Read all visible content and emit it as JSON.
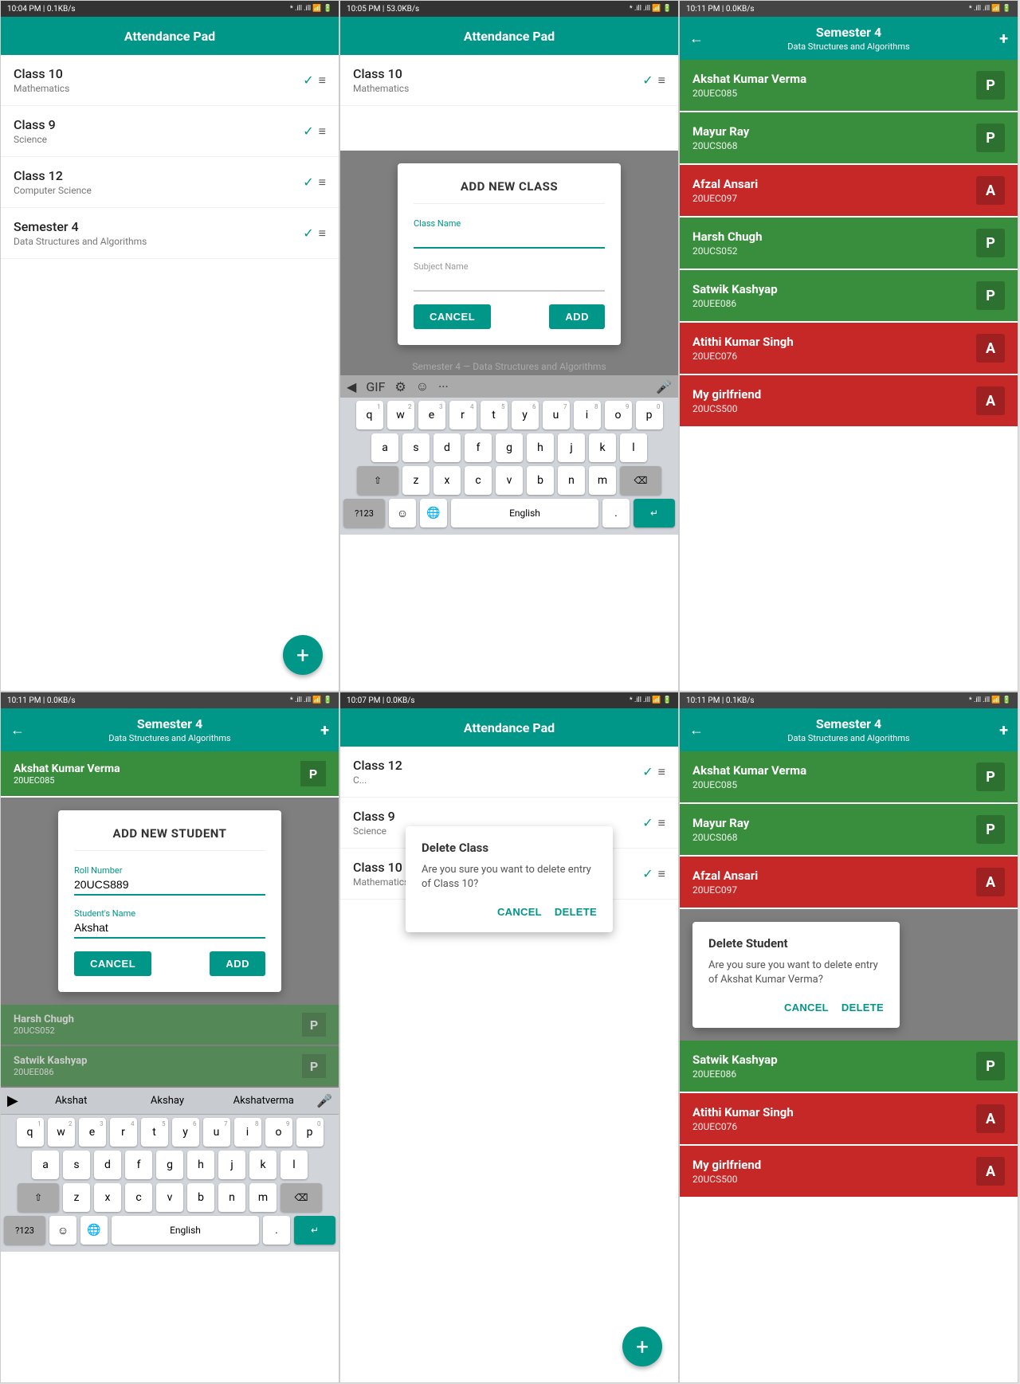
{
  "screen1": {
    "statusBar": {
      "time": "10:04 PM | 0.1KB/s",
      "icons": "bluetooth wifi battery"
    },
    "appBar": {
      "title": "Attendance Pad"
    },
    "classes": [
      {
        "title": "Class 10",
        "sub": "Mathematics"
      },
      {
        "title": "Class 9",
        "sub": "Science"
      },
      {
        "title": "Class 12",
        "sub": "Computer Science"
      },
      {
        "title": "Semester 4",
        "sub": "Data Structures and Algorithms"
      }
    ],
    "fab": "+"
  },
  "screen2": {
    "statusBar": {
      "time": "10:05 PM | 53.0KB/s",
      "icons": "bluetooth wifi battery"
    },
    "appBar": {
      "title": "Attendance Pad"
    },
    "classes": [
      {
        "title": "Class 10",
        "sub": "Mathematics"
      },
      {
        "title": "Semester 4",
        "sub": "Data Structures and Algorithms"
      }
    ],
    "dialog": {
      "title": "ADD NEW CLASS",
      "field1Label": "Class Name",
      "field1Value": "",
      "field2Label": "Subject Name",
      "field2Value": "",
      "cancelBtn": "CANCEL",
      "addBtn": "ADD"
    },
    "keyboard": {
      "toolbar": [
        "←",
        "gif",
        "⚙",
        "☺",
        "...",
        "🎤"
      ],
      "rows": [
        [
          "q",
          "w",
          "e",
          "r",
          "t",
          "y",
          "u",
          "i",
          "o",
          "p"
        ],
        [
          "a",
          "s",
          "d",
          "f",
          "g",
          "h",
          "j",
          "k",
          "l"
        ],
        [
          "⇧",
          "z",
          "x",
          "c",
          "v",
          "b",
          "n",
          "m",
          "⌫"
        ],
        [
          "?123",
          "☺",
          "🌐",
          "English",
          ".",
          "↵"
        ]
      ]
    }
  },
  "screen3": {
    "statusBar": {
      "time": "10:11 PM | 0.0KB/s",
      "icons": "bluetooth wifi battery"
    },
    "appBar": {
      "title": "Semester 4",
      "subtitle": "Data Structures and Algorithms",
      "backBtn": "←",
      "addBtn": "+"
    },
    "students": [
      {
        "name": "Akshat Kumar Verma",
        "roll": "20UEC085",
        "status": "P",
        "color": "green"
      },
      {
        "name": "Mayur Ray",
        "roll": "20UCS068",
        "status": "P",
        "color": "green"
      },
      {
        "name": "Afzal Ansari",
        "roll": "20UEC097",
        "status": "A",
        "color": "red"
      },
      {
        "name": "Harsh Chugh",
        "roll": "20UCS052",
        "status": "P",
        "color": "green"
      },
      {
        "name": "Satwik Kashyap",
        "roll": "20UEE086",
        "status": "P",
        "color": "green"
      },
      {
        "name": "Atithi Kumar Singh",
        "roll": "20UEC076",
        "status": "A",
        "color": "red"
      },
      {
        "name": "My girlfriend",
        "roll": "20UCS500",
        "status": "A",
        "color": "red"
      }
    ]
  },
  "screen4": {
    "statusBar": {
      "time": "10:11 PM | 0.0KB/s",
      "icons": "bluetooth wifi battery"
    },
    "appBar": {
      "title": "Semester 4",
      "subtitle": "Data Structures and Algorithms",
      "backBtn": "←",
      "addBtn": "+"
    },
    "students": [
      {
        "name": "Akshat Kumar Verma",
        "roll": "20UEC085",
        "status": "P",
        "color": "green"
      }
    ],
    "dialog": {
      "title": "ADD NEW STUDENT",
      "field1Label": "Roll Number",
      "field1Value": "20UCS889",
      "field2Label": "Student's Name",
      "field2Value": "Akshat",
      "cancelBtn": "CANCEL",
      "addBtn": "ADD"
    },
    "moreStudents": [
      {
        "name": "Harsh Chugh",
        "roll": "20UCS052",
        "status": "P",
        "color": "green"
      },
      {
        "name": "Satwik Kashyap",
        "roll": "20UEE086",
        "status": "P",
        "color": "green"
      }
    ],
    "keyboard": {
      "suggestions": [
        "Akshat",
        "Akshay",
        "Akshatverma"
      ],
      "rows": [
        [
          "q",
          "w",
          "e",
          "r",
          "t",
          "y",
          "u",
          "i",
          "o",
          "p"
        ],
        [
          "a",
          "s",
          "d",
          "f",
          "g",
          "h",
          "j",
          "k",
          "l"
        ],
        [
          "⇧",
          "z",
          "x",
          "c",
          "v",
          "b",
          "n",
          "m",
          "⌫"
        ],
        [
          "?123",
          "☺",
          "🌐",
          "English",
          ".",
          "↵"
        ]
      ]
    }
  },
  "screen5": {
    "statusBar": {
      "time": "10:07 PM | 0.0KB/s",
      "icons": "bluetooth wifi battery"
    },
    "appBar": {
      "title": "Attendance Pad"
    },
    "classes": [
      {
        "title": "Class 10",
        "sub": "Mathematics"
      },
      {
        "title": "Class 9",
        "sub": "Science"
      },
      {
        "title": "Class 12",
        "sub": "C..."
      }
    ],
    "dialog": {
      "title": "Delete Class",
      "text": "Are you sure you want to delete entry of Class 10?",
      "cancelBtn": "CANCEL",
      "deleteBtn": "DELETE"
    },
    "fab": "+"
  },
  "screen6": {
    "statusBar": {
      "time": "10:11 PM | 0.1KB/s",
      "icons": "bluetooth wifi battery"
    },
    "appBar": {
      "title": "Semester 4",
      "subtitle": "Data Structures and Algorithms",
      "backBtn": "←",
      "addBtn": "+"
    },
    "students": [
      {
        "name": "Akshat Kumar Verma",
        "roll": "20UEC085",
        "status": "P",
        "color": "green"
      },
      {
        "name": "Mayur Ray",
        "roll": "20UCS068",
        "status": "P",
        "color": "green"
      },
      {
        "name": "Afzal Ansari",
        "roll": "20UEC097",
        "status": "A",
        "color": "red"
      }
    ],
    "dialog": {
      "title": "Delete Student",
      "text": "Are you sure you want to delete entry of Akshat Kumar Verma?",
      "cancelBtn": "CANCEL",
      "deleteBtn": "DELETE"
    },
    "moreStudents": [
      {
        "name": "Satwik Kashyap",
        "roll": "20UEE086",
        "status": "P",
        "color": "green"
      },
      {
        "name": "Atithi Kumar Singh",
        "roll": "20UEC076",
        "status": "A",
        "color": "red"
      },
      {
        "name": "My girlfriend",
        "roll": "20UCS500",
        "status": "A",
        "color": "red"
      }
    ]
  }
}
